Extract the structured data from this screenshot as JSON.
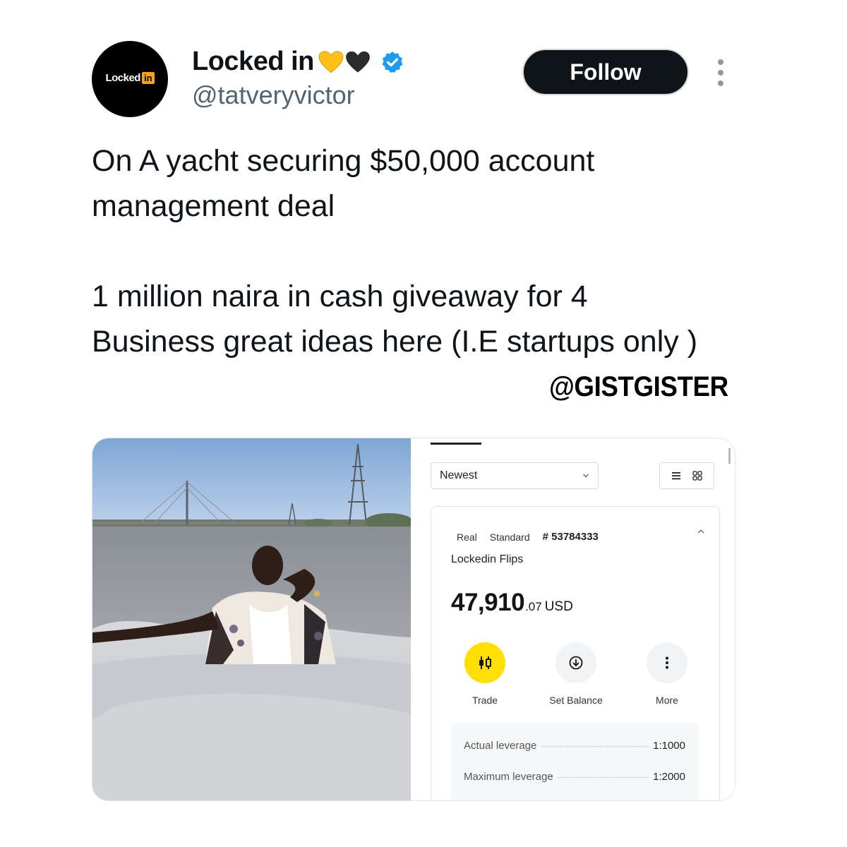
{
  "profile": {
    "avatar_logo_text": "Locked",
    "avatar_logo_box": "in",
    "display_name": "Locked in",
    "handle": "@tatveryvictor",
    "emojis": [
      "yellow-heart-icon",
      "black-heart-icon"
    ],
    "verified_icon": "verified-badge-icon"
  },
  "actions": {
    "follow_label": "Follow",
    "more_icon": "kebab-icon"
  },
  "tweet": {
    "paragraph_1": "On A yacht securing $50,000 account management deal",
    "paragraph_2": "1 million naira in cash giveaway for 4 Business great ideas here (I.E startups only )"
  },
  "watermark": "@GISTGISTER",
  "trading_screen": {
    "sort_select": "Newest",
    "account": {
      "type": "Real",
      "tier": "Standard",
      "number": "# 53784333",
      "name": "Lockedin Flips",
      "balance_main": "47,910",
      "balance_cents": ".07",
      "currency": "USD"
    },
    "buttons": {
      "trade": "Trade",
      "set_balance": "Set Balance",
      "more": "More"
    },
    "leverage": {
      "actual_label": "Actual leverage",
      "actual_value": "1:1000",
      "max_label": "Maximum leverage",
      "max_value": "1:2000"
    }
  },
  "colors": {
    "follow_bg": "#0f1419",
    "verified": "#1d9bf0",
    "trade_yellow": "#ffde02",
    "handle_gray": "#536471"
  }
}
